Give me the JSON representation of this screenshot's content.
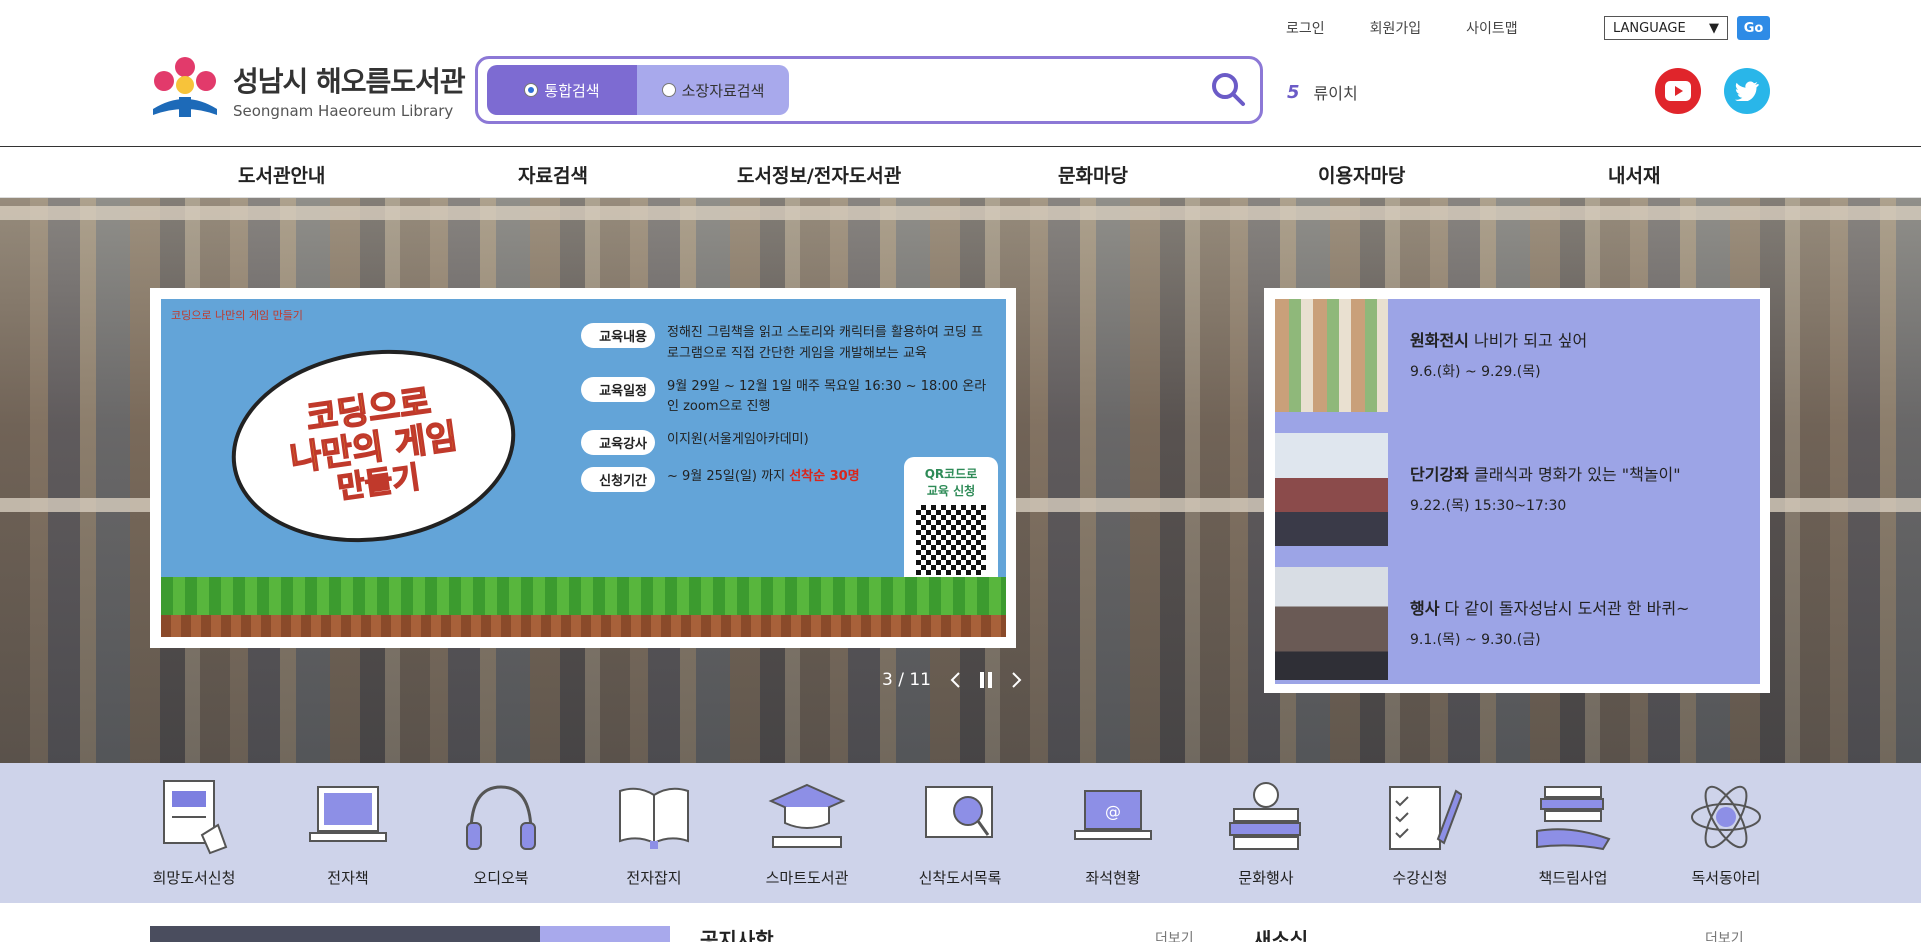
{
  "utility": {
    "login": "로그인",
    "join": "회원가입",
    "sitemap": "사이트맵",
    "language": "LANGUAGE",
    "go": "Go"
  },
  "logo": {
    "title": "성남시 해오름도서관",
    "subtitle": "Seongnam Haeoreum Library"
  },
  "search": {
    "tab_all": "통합검색",
    "tab_collection": "소장자료검색",
    "placeholder": ""
  },
  "keyword": {
    "rank": "5",
    "word": "류이치"
  },
  "gnb": [
    "도서관안내",
    "자료검색",
    "도서정보/전자도서관",
    "문화마당",
    "이용자마당",
    "내서재"
  ],
  "banner": {
    "small": "코딩으로 나만의 게임 만들기",
    "title_line1": "코딩으로",
    "title_line2": "나만의 게임",
    "title_line3": "만들기",
    "rows": [
      {
        "badge": "교육내용",
        "text": "정해진 그림책을 읽고 스토리와 캐릭터를 활용하여 코딩 프로그램으로 직접 간단한 게임을 개발해보는 교육"
      },
      {
        "badge": "교육일정",
        "text": "9월 29일 ~ 12월 1일  매주 목요일  16:30 ~ 18:00 온라인 zoom으로 진행"
      },
      {
        "badge": "교육강사",
        "text": "이지원(서울게임아카데미)"
      },
      {
        "badge": "신청기간",
        "text": "~ 9월 25일(일) 까지"
      }
    ],
    "highlight": "선착순 30명",
    "qr_line1": "QR코드로",
    "qr_line2": "교육 신청"
  },
  "slider": {
    "counter": "3 / 11"
  },
  "news": [
    {
      "category": "원화전시",
      "title": "나비가 되고 싶어",
      "date": "9.6.(화) ~ 9.29.(목)"
    },
    {
      "category": "단기강좌",
      "title": "클래식과 명화가 있는 \"책놀이\"",
      "date": "9.22.(목) 15:30~17:30"
    },
    {
      "category": "행사",
      "title": "다 같이 돌자성남시 도서관 한 바퀴~",
      "date": "9.1.(목) ~ 9.30.(금)"
    }
  ],
  "quick": [
    "희망도서신청",
    "전자책",
    "오디오북",
    "전자잡지",
    "스마트도서관",
    "신착도서목록",
    "좌석현황",
    "문화행사",
    "수강신청",
    "책드림사업",
    "독서동아리"
  ],
  "bottom": {
    "notice": "공지사항",
    "news": "새소식",
    "more": "더보기"
  }
}
